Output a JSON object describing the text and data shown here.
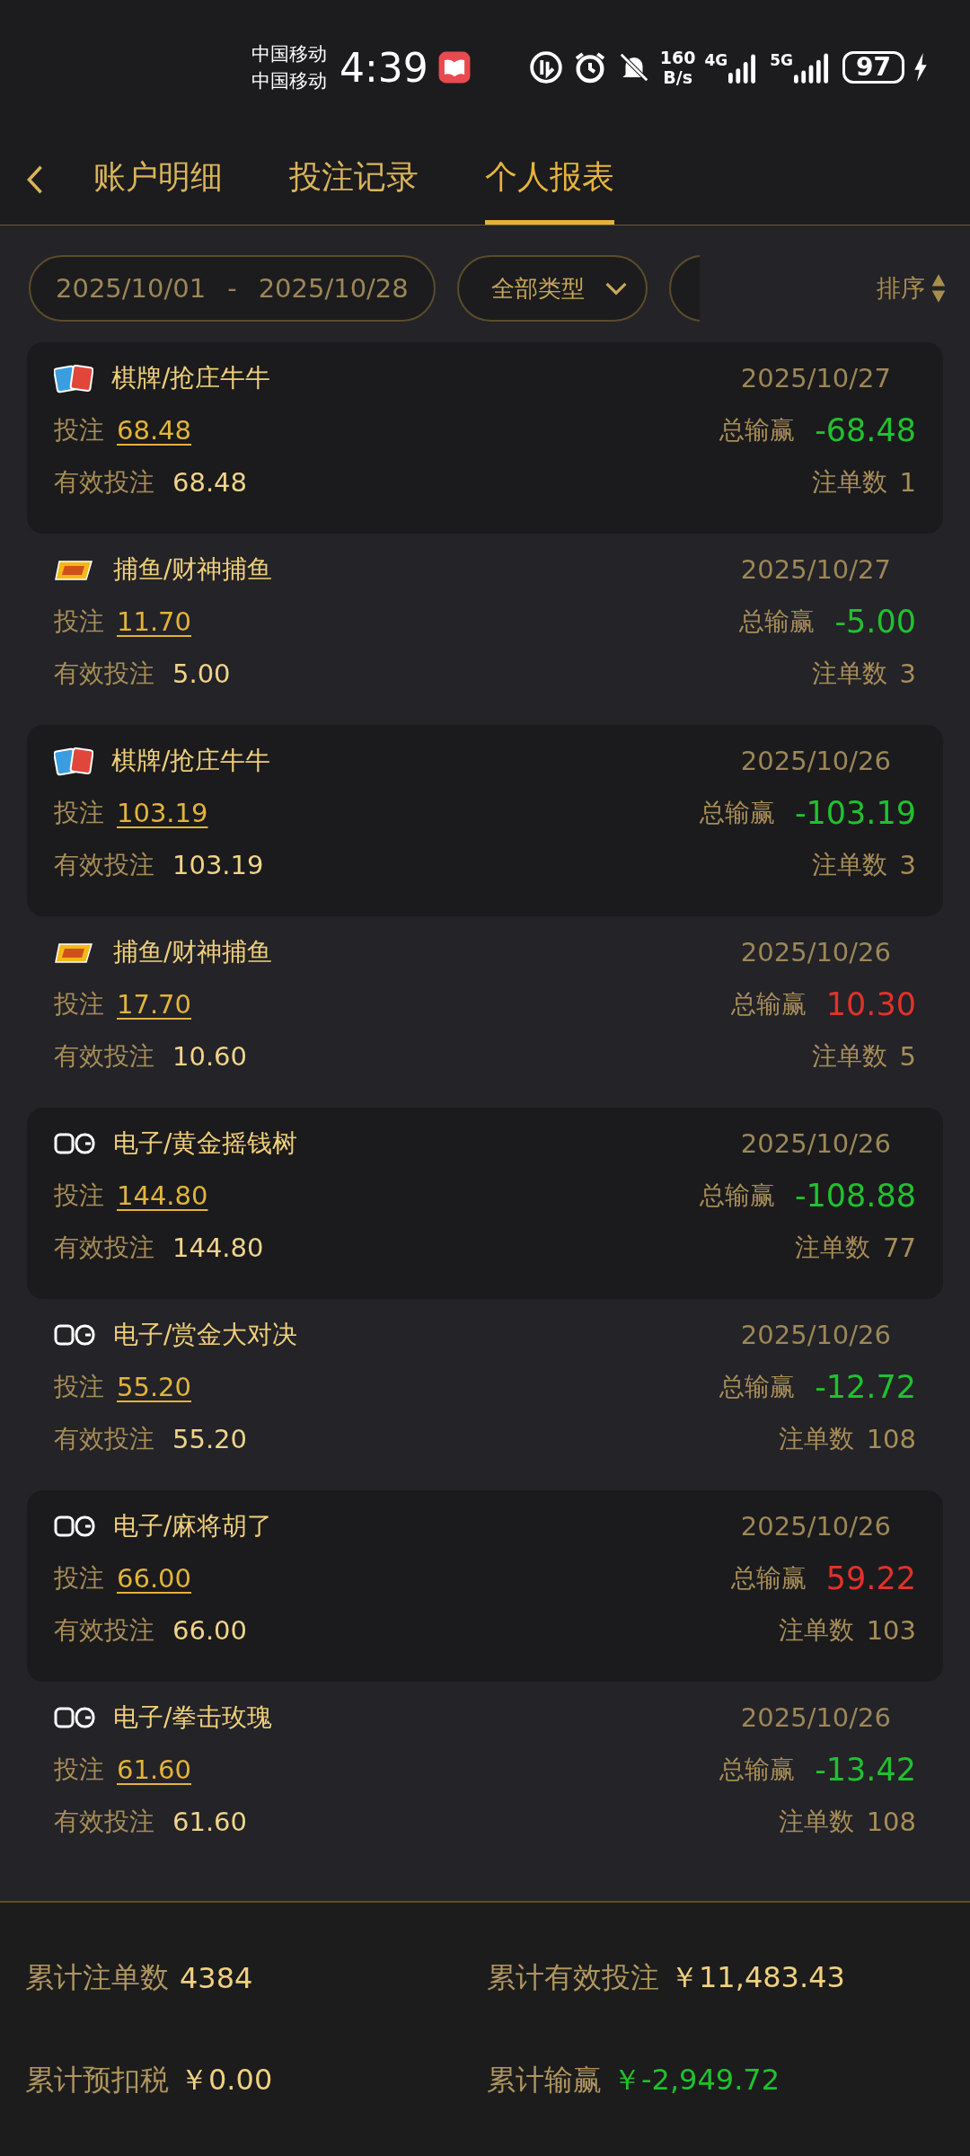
{
  "status_bar": {
    "carriers": [
      "中国移动",
      "中国移动"
    ],
    "time": "4:39",
    "speed_value": "160",
    "speed_unit": "B/s",
    "net_1": "4G",
    "net_2": "5G",
    "battery": "97"
  },
  "header": {
    "tabs": [
      {
        "label": "账户明细",
        "selected": false
      },
      {
        "label": "投注记录",
        "selected": false
      },
      {
        "label": "个人报表",
        "selected": true
      }
    ]
  },
  "filters": {
    "date_from": "2025/10/01",
    "date_sep": "-",
    "date_to": "2025/10/28",
    "type": "全部类型",
    "sort": "排序"
  },
  "records": [
    {
      "kind": "cards",
      "title": "棋牌/抢庄牛牛",
      "date": "2025/10/27",
      "bet_label": "投注",
      "bet": "68.48",
      "result_label": "总输赢",
      "result": "-68.48",
      "color": "#20c12e",
      "valid_label": "有效投注",
      "valid": "68.48",
      "count_label": "注单数",
      "count": "1"
    },
    {
      "kind": "fishing",
      "title": "捕鱼/财神捕鱼",
      "date": "2025/10/27",
      "bet_label": "投注",
      "bet": "11.70",
      "result_label": "总输赢",
      "result": "-5.00",
      "color": "#20c12e",
      "valid_label": "有效投注",
      "valid": "5.00",
      "count_label": "注单数",
      "count": "3"
    },
    {
      "kind": "cards",
      "title": "棋牌/抢庄牛牛",
      "date": "2025/10/26",
      "bet_label": "投注",
      "bet": "103.19",
      "result_label": "总输赢",
      "result": "-103.19",
      "color": "#20c12e",
      "valid_label": "有效投注",
      "valid": "103.19",
      "count_label": "注单数",
      "count": "3"
    },
    {
      "kind": "fishing",
      "title": "捕鱼/财神捕鱼",
      "date": "2025/10/26",
      "bet_label": "投注",
      "bet": "17.70",
      "result_label": "总输赢",
      "result": "10.30",
      "color": "#e0322a",
      "valid_label": "有效投注",
      "valid": "10.60",
      "count_label": "注单数",
      "count": "5"
    },
    {
      "kind": "slots",
      "title": "电子/黄金摇钱树",
      "date": "2025/10/26",
      "bet_label": "投注",
      "bet": "144.80",
      "result_label": "总输赢",
      "result": "-108.88",
      "color": "#20c12e",
      "valid_label": "有效投注",
      "valid": "144.80",
      "count_label": "注单数",
      "count": "77"
    },
    {
      "kind": "slots",
      "title": "电子/赏金大对决",
      "date": "2025/10/26",
      "bet_label": "投注",
      "bet": "55.20",
      "result_label": "总输赢",
      "result": "-12.72",
      "color": "#20c12e",
      "valid_label": "有效投注",
      "valid": "55.20",
      "count_label": "注单数",
      "count": "108"
    },
    {
      "kind": "slots",
      "title": "电子/麻将胡了",
      "date": "2025/10/26",
      "bet_label": "投注",
      "bet": "66.00",
      "result_label": "总输赢",
      "result": "59.22",
      "color": "#e0322a",
      "valid_label": "有效投注",
      "valid": "66.00",
      "count_label": "注单数",
      "count": "103"
    },
    {
      "kind": "slots",
      "title": "电子/拳击玫瑰",
      "date": "2025/10/26",
      "bet_label": "投注",
      "bet": "61.60",
      "result_label": "总输赢",
      "result": "-13.42",
      "color": "#20c12e",
      "valid_label": "有效投注",
      "valid": "61.60",
      "count_label": "注单数",
      "count": "108"
    }
  ],
  "summary": [
    {
      "label": "累计注单数",
      "value": "4384",
      "color": "#f0d080"
    },
    {
      "label": "累计有效投注",
      "value": "￥11,483.43",
      "color": "#f0d080"
    },
    {
      "label": "累计预扣税",
      "value": "￥0.00",
      "color": "#f0d080"
    },
    {
      "label": "累计输赢",
      "value": "￥-2,949.72",
      "color": "#20c12e"
    }
  ]
}
